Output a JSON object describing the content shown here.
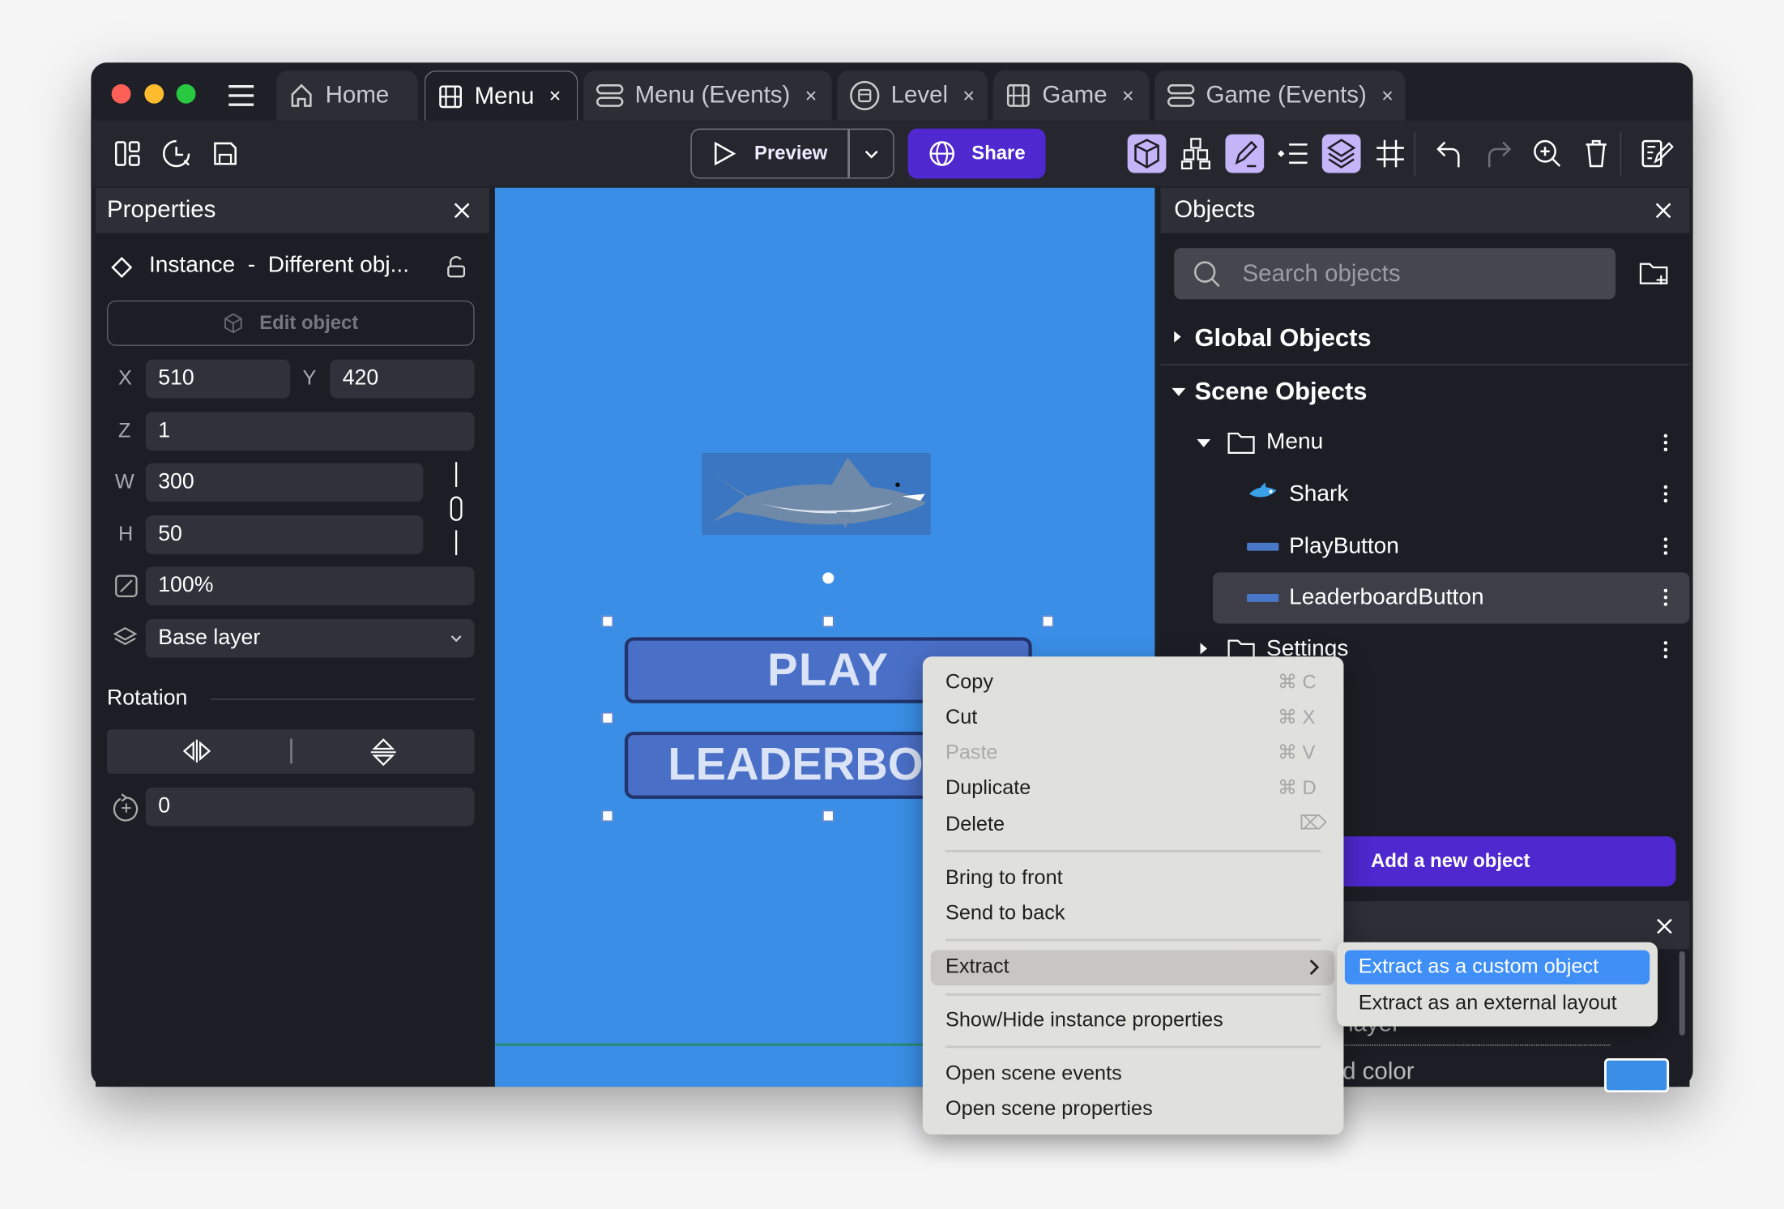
{
  "tabs": [
    {
      "label": "Home",
      "icon": "home-icon",
      "closable": false,
      "active": false
    },
    {
      "label": "Menu",
      "icon": "film-icon",
      "closable": true,
      "active": true
    },
    {
      "label": "Menu (Events)",
      "icon": "events-icon",
      "closable": true,
      "active": false
    },
    {
      "label": "Level",
      "icon": "external-layout-icon",
      "closable": true,
      "active": false
    },
    {
      "label": "Game",
      "icon": "film-icon",
      "closable": true,
      "active": false
    },
    {
      "label": "Game (Events)",
      "icon": "events-icon",
      "closable": true,
      "active": false
    }
  ],
  "close_glyph": "×",
  "toolbar": {
    "preview_label": "Preview",
    "share_label": "Share",
    "active_tools": [
      "objects-panel",
      "instances-editor",
      "layers"
    ]
  },
  "properties": {
    "title": "Properties",
    "instance_label": "Instance  -  Different obj...",
    "edit_object_label": "Edit object",
    "x_label": "X",
    "x": "510",
    "y_label": "Y",
    "y": "420",
    "z_label": "Z",
    "z": "1",
    "w_label": "W",
    "w": "300",
    "h_label": "H",
    "h": "50",
    "opacity": "100%",
    "layer": "Base layer",
    "rotation_label": "Rotation",
    "angle": "0"
  },
  "canvas": {
    "play_text": "PLAY",
    "leaderboard_text": "LEADERBOA",
    "background_color": "#3a8ee6"
  },
  "objects": {
    "title": "Objects",
    "search_placeholder": "Search objects",
    "global_label": "Global Objects",
    "scene_label": "Scene Objects",
    "folder_menu": "Menu",
    "items": [
      {
        "label": "Shark",
        "icon": "shark-sprite-icon",
        "selected": false
      },
      {
        "label": "PlayButton",
        "icon": "panel-sprite-icon",
        "selected": false
      },
      {
        "label": "LeaderboardButton",
        "icon": "panel-sprite-icon",
        "selected": true
      }
    ],
    "folder_settings": "Settings",
    "add_label": "Add a new object"
  },
  "lower_panel": {
    "layer_text": "layer",
    "bg_color_text": "d color",
    "swatch_color": "#3a8ee6"
  },
  "context_menu": {
    "items": [
      {
        "label": "Copy",
        "shortcut": "⌘ C",
        "disabled": false
      },
      {
        "label": "Cut",
        "shortcut": "⌘ X",
        "disabled": false
      },
      {
        "label": "Paste",
        "shortcut": "⌘ V",
        "disabled": true
      },
      {
        "label": "Duplicate",
        "shortcut": "⌘ D",
        "disabled": false
      },
      {
        "label": "Delete",
        "shortcut": "⌦",
        "disabled": false
      },
      {
        "label": "Bring to front"
      },
      {
        "label": "Send to back"
      },
      {
        "label": "Extract",
        "highlighted": true
      },
      {
        "label": "Show/Hide instance properties"
      },
      {
        "label": "Open scene events"
      },
      {
        "label": "Open scene properties"
      }
    ],
    "submenu": [
      {
        "label": "Extract as a custom object",
        "highlighted": true
      },
      {
        "label": "Extract as an external layout"
      }
    ]
  }
}
